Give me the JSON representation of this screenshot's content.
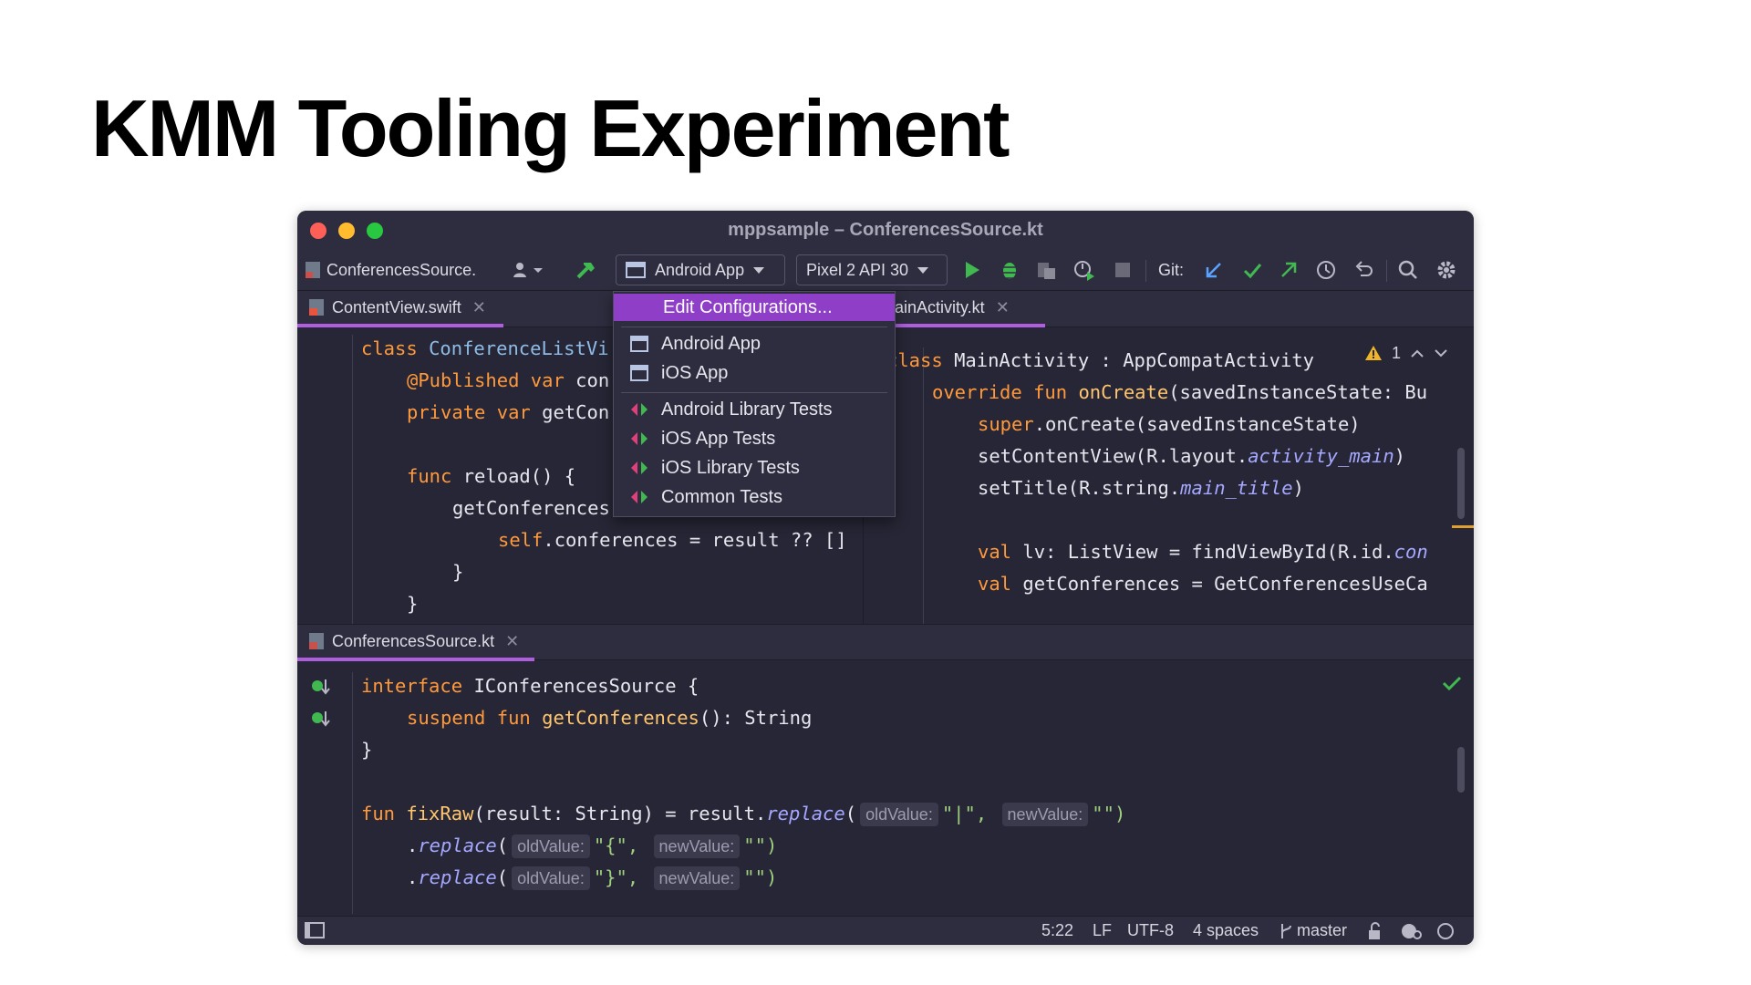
{
  "slide": {
    "title": "KMM Tooling Experiment"
  },
  "window": {
    "title": "mppsample – ConferencesSource.kt"
  },
  "toolbar": {
    "project_label": "ConferencesSource.",
    "run_config": "Android App",
    "device": "Pixel 2 API 30",
    "git_label": "Git:"
  },
  "run_config_menu": {
    "edit_label": "Edit Configurations...",
    "apps": [
      "Android App",
      "iOS App"
    ],
    "tests": [
      "Android Library Tests",
      "iOS App Tests",
      "iOS Library Tests",
      "Common Tests"
    ]
  },
  "tabs": {
    "left": "ContentView.swift",
    "right": "MainActivity.kt",
    "bottom": "ConferencesSource.kt"
  },
  "editor_inspection": {
    "warning_count": "1"
  },
  "swift_code": {
    "l1_kw": "class",
    "l1_type": "ConferenceListVi",
    "l2_kw": "@Published var",
    "l2_tx": "con",
    "l3_kw": "private var",
    "l3_tx": "getCon",
    "l4_kw": "func",
    "l4_tx": "reload() {",
    "l5_tx": "getConferences",
    "l6_kw": "self",
    "l6_tx": ".conferences = result ?? []",
    "l7_tx": "}",
    "l8_tx": "}"
  },
  "kotlin_main_code": {
    "l1_kw": "class",
    "l1_tx": "MainActivity : AppCompatActivity",
    "l2_kw": "override fun",
    "l2_fn": "onCreate",
    "l2_tx": "(savedInstanceState: Bu",
    "l3_kw": "super",
    "l3_tx": ".onCreate(savedInstanceState)",
    "l4_tx": "setContentView(R.layout.",
    "l4_it": "activity_main",
    "l4_end": ")",
    "l5_tx": "setTitle(R.string.",
    "l5_it": "main_title",
    "l5_end": ")",
    "l6_kw": "val",
    "l6_tx": "lv: ListView = findViewById(R.id.",
    "l6_it": "con",
    "l7_kw": "val",
    "l7_tx": "getConferences = GetConferencesUseCa"
  },
  "kotlin_source_code": {
    "l1_kw": "interface",
    "l1_tx": "IConferencesSource {",
    "l2_kw": "suspend fun",
    "l2_fn": "getConferences",
    "l2_tx": "(): String",
    "l3_tx": "}",
    "l4_kw": "fun",
    "l4_fn": "fixRaw",
    "l4_tx": "(result: String) = result.",
    "l4_it": "replace",
    "l4_paren": "(",
    "hint_old": "oldValue:",
    "hint_new": "newValue:",
    "l4_s1": "\"|\",",
    "l4_s2": "\"\")",
    "l5_dot": ".",
    "l5_it": "replace",
    "l5_paren": "(",
    "l5_s1": "\"{\",",
    "l5_s2": "\"\")",
    "l6_dot": ".",
    "l6_it": "replace",
    "l6_paren": "(",
    "l6_s1": "\"}\",",
    "l6_s2": "\"\")"
  },
  "statusbar": {
    "position": "5:22",
    "line_sep": "LF",
    "encoding": "UTF-8",
    "indent": "4 spaces",
    "branch": "master"
  },
  "colors": {
    "accent": "#8f3ec7",
    "keyword": "#ff9a3c",
    "function": "#ffc66d",
    "string": "#9ed07e",
    "run": "#3fb950"
  }
}
